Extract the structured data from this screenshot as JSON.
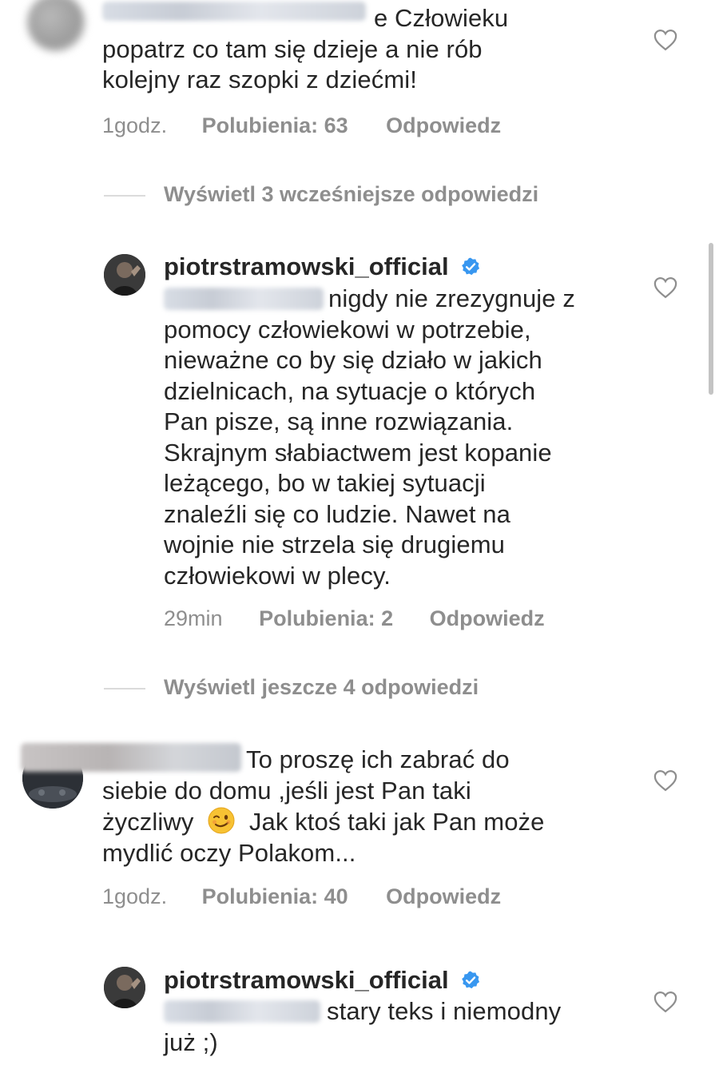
{
  "comments": [
    {
      "text_visible": "e Człowieku",
      "text_line2": "popatrz co tam się dzieje a nie rób",
      "text_line3": "kolejny raz szopki z dziećmi!",
      "time": "1godz.",
      "likes": "Polubienia: 63",
      "reply": "Odpowiedz"
    },
    {
      "username": "piotrstramowski_official",
      "lines": [
        "nigdy nie zrezygnuje z",
        "pomocy człowiekowi w potrzebie,",
        "nieważne co by się działo w jakich",
        "dzielnicach, na sytuacje o których",
        "Pan pisze, są inne rozwiązania.",
        "Skrajnym słabiactwem jest kopanie",
        "leżącego, bo w takiej sytuacji",
        "znaleźli się co ludzie. Nawet na",
        "wojnie nie strzela się drugiemu",
        "człowiekowi w plecy."
      ],
      "time": "29min",
      "likes": "Polubienia: 2",
      "reply": "Odpowiedz"
    },
    {
      "lines": [
        "To proszę ich zabrać do",
        "siebie do domu ,jeśli jest Pan taki",
        "życzliwy",
        "Jak ktoś taki jak Pan może",
        "mydlić oczy Polakom..."
      ],
      "emoji": "😉",
      "time": "1godz.",
      "likes": "Polubienia: 40",
      "reply": "Odpowiedz"
    },
    {
      "username": "piotrstramowski_official",
      "lines": [
        "stary teks i niemodny",
        "już ;)"
      ]
    }
  ],
  "view_more": [
    "Wyświetl 3 wcześniejsze odpowiedzi",
    "Wyświetl jeszcze 4 odpowiedzi"
  ],
  "colors": {
    "text": "#262626",
    "meta": "#8e8e8e",
    "verified": "#3897f0"
  }
}
